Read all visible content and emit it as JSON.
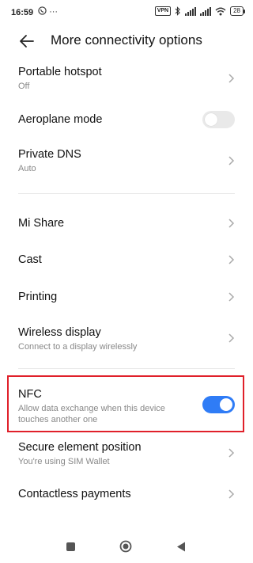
{
  "status_bar": {
    "time": "16:59",
    "left_icons": [
      "whatsapp-icon",
      "more-notifications-icon"
    ],
    "left_dots": "···",
    "vpn": "VPN",
    "battery": "28",
    "icons": [
      "vpn-icon",
      "bluetooth-icon",
      "signal-icon",
      "signal-icon",
      "wifi-icon",
      "battery-icon"
    ]
  },
  "header": {
    "title": "More connectivity options",
    "back_icon": "back-arrow-icon"
  },
  "rows": [
    {
      "title": "Portable hotspot",
      "subtitle": "Off",
      "control": "chevron"
    },
    {
      "title": "Aeroplane mode",
      "control": "toggle",
      "toggle_on": false
    },
    {
      "title": "Private DNS",
      "subtitle": "Auto",
      "control": "chevron"
    },
    {
      "title": "Mi Share",
      "control": "chevron"
    },
    {
      "title": "Cast",
      "control": "chevron"
    },
    {
      "title": "Printing",
      "control": "chevron"
    },
    {
      "title": "Wireless display",
      "subtitle": "Connect to a display wirelessly",
      "control": "chevron"
    },
    {
      "title": "NFC",
      "subtitle_line1": "Allow data exchange when this device",
      "subtitle_line2": "touches another one",
      "control": "toggle",
      "toggle_on": true,
      "highlighted": true
    },
    {
      "title": "Secure element position",
      "subtitle": "You're using SIM  Wallet",
      "control": "chevron"
    },
    {
      "title": "Contactless payments",
      "control": "chevron"
    }
  ],
  "colors": {
    "accent": "#2f7cf6",
    "highlight_border": "#e0202a",
    "subtitle": "#888888",
    "toggle_off": "#e9e9e9"
  },
  "nav_bar": {
    "buttons": [
      "recents-square-icon",
      "home-circle-icon",
      "back-triangle-icon"
    ]
  }
}
